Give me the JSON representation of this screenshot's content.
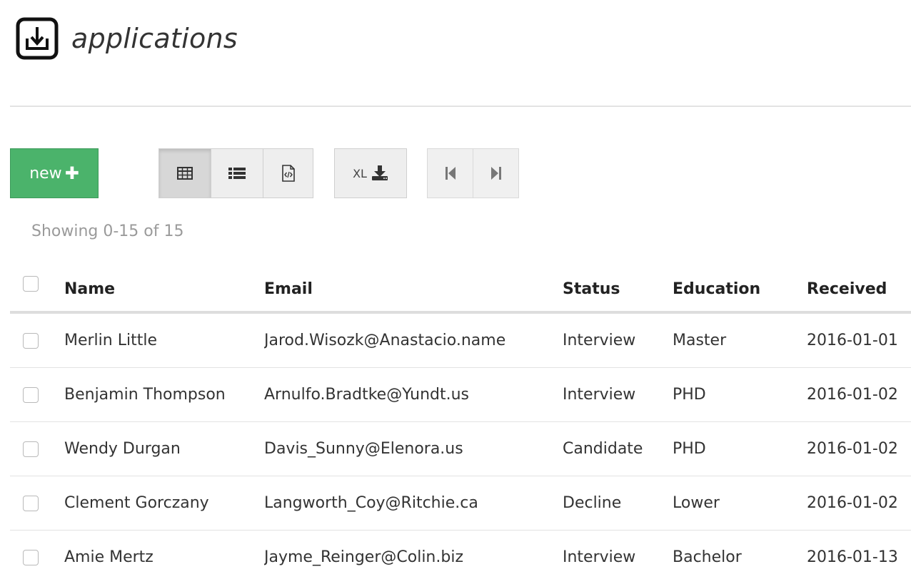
{
  "header": {
    "title": "applications",
    "icon": "download-tray-icon"
  },
  "toolbar": {
    "new_label": "new",
    "new_icon": "plus-icon",
    "new_color": "#4bb36b",
    "view_buttons": [
      {
        "icon": "table-grid-icon",
        "active": true
      },
      {
        "icon": "list-icon",
        "active": false
      },
      {
        "icon": "code-file-icon",
        "active": false
      }
    ],
    "export_label": "XL",
    "export_icon": "download-icon",
    "nav_buttons": [
      {
        "icon": "first-page-icon"
      },
      {
        "icon": "last-page-icon"
      }
    ]
  },
  "pagination": {
    "showing_text": "Showing 0-15 of 15"
  },
  "table": {
    "columns": [
      "Name",
      "Email",
      "Status",
      "Education",
      "Received"
    ],
    "rows": [
      {
        "name": "Merlin Little",
        "email": "Jarod.Wisozk@Anastacio.name",
        "status": "Interview",
        "education": "Master",
        "received": "2016-01-01"
      },
      {
        "name": "Benjamin Thompson",
        "email": "Arnulfo.Bradtke@Yundt.us",
        "status": "Interview",
        "education": "PHD",
        "received": "2016-01-02"
      },
      {
        "name": "Wendy Durgan",
        "email": "Davis_Sunny@Elenora.us",
        "status": "Candidate",
        "education": "PHD",
        "received": "2016-01-02"
      },
      {
        "name": "Clement Gorczany",
        "email": "Langworth_Coy@Ritchie.ca",
        "status": "Decline",
        "education": "Lower",
        "received": "2016-01-02"
      },
      {
        "name": "Amie Mertz",
        "email": "Jayme_Reinger@Colin.biz",
        "status": "Interview",
        "education": "Bachelor",
        "received": "2016-01-13"
      }
    ]
  }
}
